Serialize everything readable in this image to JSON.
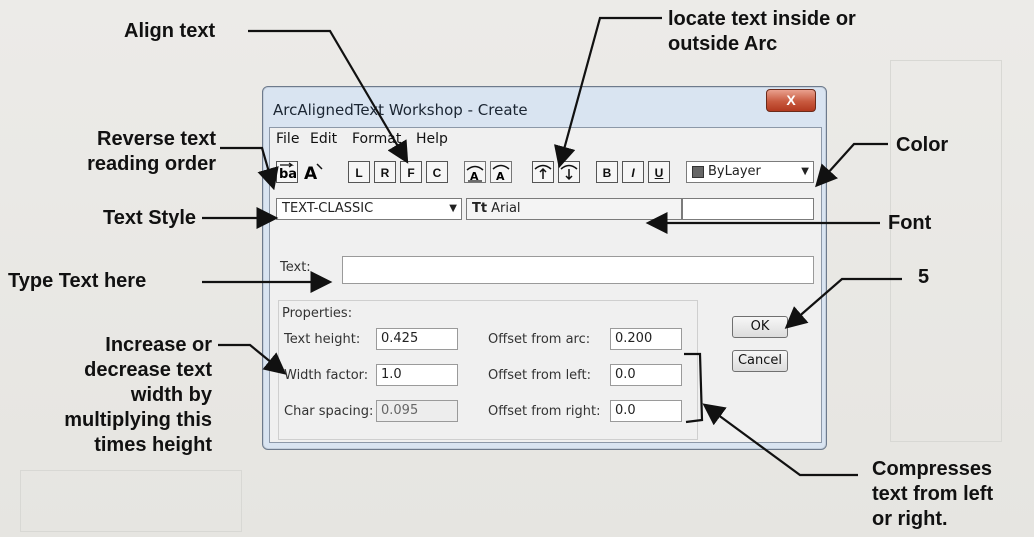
{
  "callouts": {
    "align_text": "Align text",
    "locate_text_line1": "locate text inside or",
    "locate_text_line2": "outside Arc",
    "reverse_line1": "Reverse text",
    "reverse_line2": "reading order",
    "color": "Color",
    "text_style": "Text Style",
    "font": "Font",
    "type_text": "Type Text here",
    "five": "5",
    "increase_line1": "Increase or",
    "increase_line2": "decrease  text",
    "increase_line3": "width by",
    "increase_line4": "multiplying this",
    "increase_line5": "times height",
    "compress_line1": "Compresses",
    "compress_line2": "text from left",
    "compress_line3": "or right."
  },
  "window": {
    "title": "ArcAlignedText Workshop - Create",
    "close_label": "X"
  },
  "menu": [
    "File",
    "Edit",
    "Format",
    "Help"
  ],
  "toolbar": {
    "align_left": "L",
    "align_right": "R",
    "align_fit": "F",
    "align_center": "C",
    "bold": "B",
    "italic": "I",
    "underline": "U",
    "color_value": "ByLayer",
    "color_swatch": "#666666"
  },
  "style_select": {
    "value": "TEXT-CLASSIC"
  },
  "font_select": {
    "value": "Arial"
  },
  "form": {
    "text_label": "Text:",
    "text_value": "",
    "properties_label": "Properties:",
    "text_height_label": "Text height:",
    "text_height": "0.425",
    "width_factor_label": "Width factor:",
    "width_factor": "1.0",
    "char_spacing_label": "Char spacing:",
    "char_spacing": "0.095",
    "offset_arc_label": "Offset from arc:",
    "offset_arc": "0.200",
    "offset_left_label": "Offset from left:",
    "offset_left": "0.0",
    "offset_right_label": "Offset from right:",
    "offset_right": "0.0"
  },
  "buttons": {
    "ok": "OK",
    "cancel": "Cancel"
  }
}
